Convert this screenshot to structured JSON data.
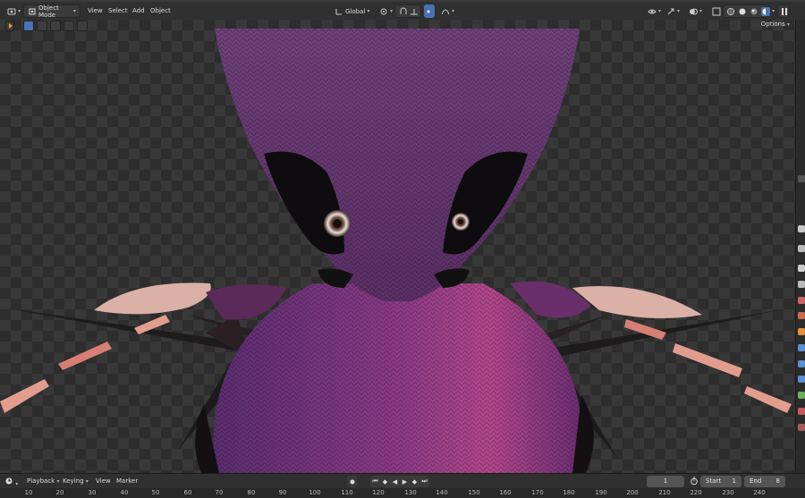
{
  "header": {
    "editor_type_icon": "editor-type-icon",
    "mode_label": "Object Mode",
    "menus": [
      "View",
      "Select",
      "Add",
      "Object"
    ],
    "transform_orientation": "Global",
    "options_label": "Options"
  },
  "viewport": {
    "background_colors": [
      "#383838",
      "#2d2d2d"
    ],
    "subject_colors": [
      "#7a3a82",
      "#a2417f",
      "#5d2a6a",
      "#e8a39a"
    ]
  },
  "timeline": {
    "menus": [
      "Playback",
      "Keying",
      "View",
      "Marker"
    ],
    "current_frame": "1",
    "start_label": "Start",
    "start_value": "1",
    "end_label": "End",
    "end_value": "8",
    "ruler_ticks": [
      "10",
      "20",
      "30",
      "40",
      "50",
      "60",
      "70",
      "80",
      "90",
      "100",
      "110",
      "120",
      "130",
      "140",
      "150",
      "160",
      "170",
      "180",
      "190",
      "200",
      "210",
      "220",
      "230",
      "240"
    ]
  },
  "accent_color": "#4772b3"
}
